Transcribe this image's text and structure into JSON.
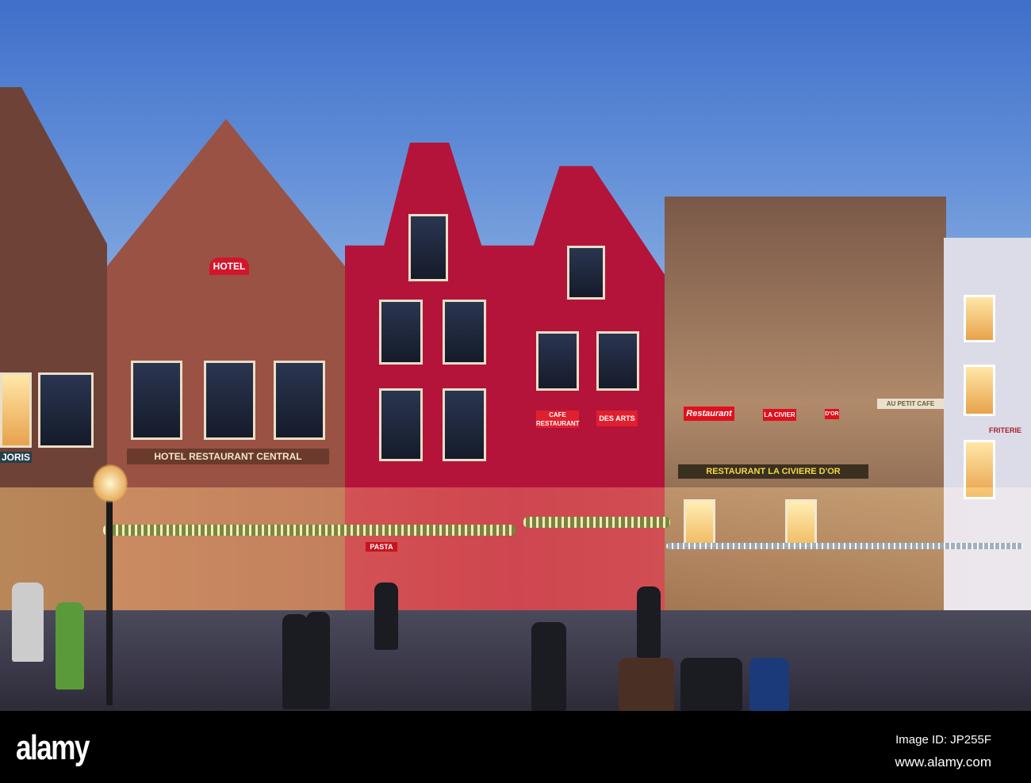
{
  "signs": {
    "hotel": "HOTEL",
    "hotel_restaurant": "HOTEL  RESTAURANT  CENTRAL",
    "joris": "JORIS",
    "cafe": "CAFE RESTAURANT",
    "des_arts": "DES ARTS",
    "pasta": "PASTA",
    "restaurant_red": "Restaurant",
    "la_civiere_red": "LA CIVIER",
    "dor_red": "D'OR",
    "au_petit_cafe": "AU PETIT CAFE",
    "civiere": "RESTAURANT LA CIVIERE D'OR",
    "friterie": "FRITERIE"
  },
  "watermark": {
    "logo": "alamy",
    "image_id": "Image ID: JP255F",
    "url": "www.alamy.com"
  },
  "colors": {
    "sky": "#5d8ad6",
    "red_facade": "#b4143a",
    "brick": "#7a4a3c"
  }
}
